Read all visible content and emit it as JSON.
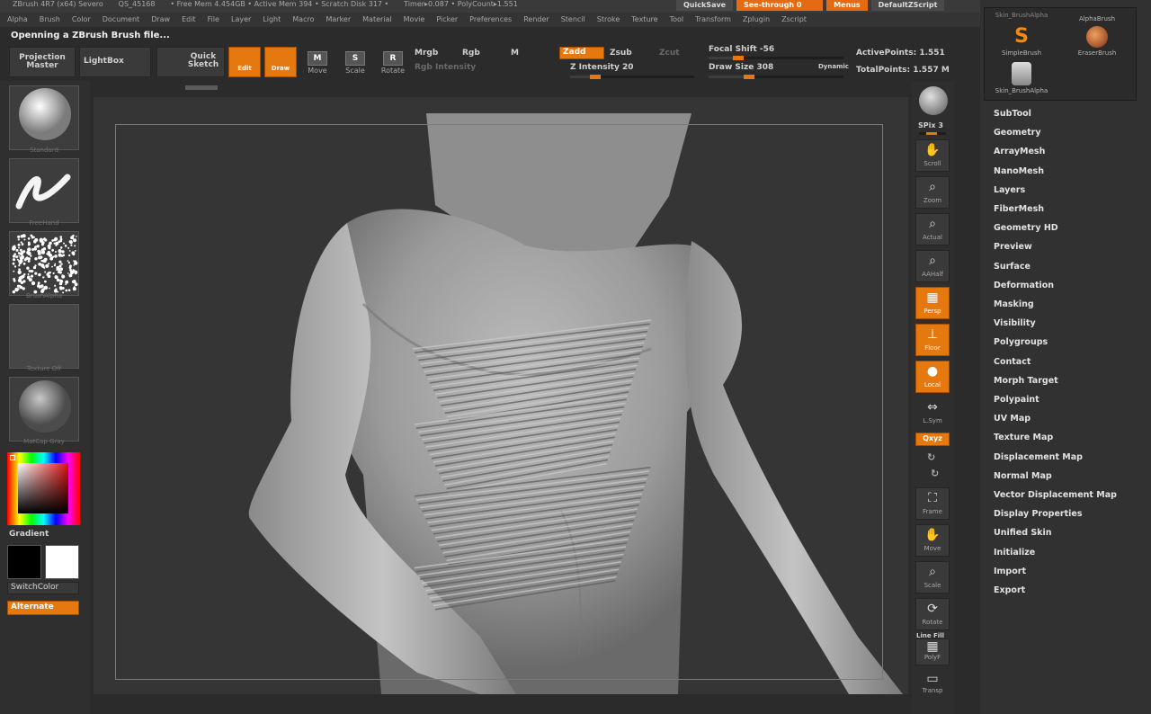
{
  "titlebar": {
    "segments": [
      "ZBrush 4R7 (x64) Severo",
      "QS_45168",
      "• Free Mem 4.454GB • Active Mem 394 • Scratch Disk 317 •",
      "Timer▸0.087 • PolyCount▸1.551"
    ],
    "quicksave": "QuickSave",
    "seethrough": "See-through 0",
    "menus": "Menus",
    "script": "DefaultZScript"
  },
  "menubar": [
    "Alpha",
    "Brush",
    "Color",
    "Document",
    "Draw",
    "Edit",
    "File",
    "Layer",
    "Light",
    "Macro",
    "Marker",
    "Material",
    "Movie",
    "Picker",
    "Preferences",
    "Render",
    "Stencil",
    "Stroke",
    "Texture",
    "Tool",
    "Transform",
    "Zplugin",
    "Zscript"
  ],
  "status": "Openning a ZBrush Brush file...",
  "toolbar": {
    "projection_master": "Projection Master",
    "lightbox": "LightBox",
    "quick_sketch": "Quick Sketch",
    "edit": "Edit",
    "draw": "Draw",
    "move": "Move",
    "scale": "Scale",
    "rotate": "Rotate",
    "mrgb": "Mrgb",
    "rgb": "Rgb",
    "m": "M",
    "rgb_intensity": "Rgb Intensity",
    "zadd": "Zadd",
    "zsub": "Zsub",
    "zcut": "Zcut",
    "z_intensity": "Z Intensity 20",
    "focal_shift": "Focal Shift -56",
    "draw_size": "Draw Size 308",
    "dynamic": "Dynamic",
    "active_points": "ActivePoints: 1.551",
    "total_points": "TotalPoints: 1.557 M"
  },
  "sliders": {
    "z_intensity_fraction": 0.2,
    "focal_shift_fraction": 0.22,
    "draw_size_fraction": 0.3
  },
  "leftshelf": {
    "material_caption": "Standard",
    "stroke_caption": "FreeHand",
    "alpha_caption": "BrushAlpha",
    "texture_caption": "Texture Off",
    "matcap_caption": "MatCap Gray",
    "gradient": "Gradient",
    "switch_color": "SwitchColor",
    "alternate": "Alternate"
  },
  "rightshelf": {
    "spix": "SPix 3",
    "scroll": "Scroll",
    "zoom": "Zoom",
    "actual": "Actual",
    "aahalf": "AAHalf",
    "persp": "Persp",
    "floor": "Floor",
    "local": "Local",
    "lsym": "L.Sym",
    "qxyz": "Qxyz",
    "frame": "Frame",
    "move": "Move",
    "scale": "Scale",
    "rotate": "Rotate",
    "linefill": "Line Fill",
    "polyf": "PolyF",
    "transp": "Transp"
  },
  "brushpop": {
    "top_label": "Skin_BrushAlpha",
    "alpha_label": "AlphaBrush",
    "simple_label": "SimpleBrush",
    "eraser_label": "EraserBrush",
    "skin_label": "Skin_BrushAlpha"
  },
  "tool_menu": [
    "SubTool",
    "Geometry",
    "ArrayMesh",
    "NanoMesh",
    "Layers",
    "FiberMesh",
    "Geometry HD",
    "Preview",
    "Surface",
    "Deformation",
    "Masking",
    "Visibility",
    "Polygroups",
    "Contact",
    "Morph Target",
    "Polypaint",
    "UV Map",
    "Texture Map",
    "Displacement Map",
    "Normal Map",
    "Vector Displacement Map",
    "Display Properties",
    "Unified Skin",
    "Initialize",
    "Import",
    "Export"
  ],
  "colors": {
    "accent": "#e5790f",
    "background": "#2b2b2b",
    "model": "#9a9a9a"
  }
}
